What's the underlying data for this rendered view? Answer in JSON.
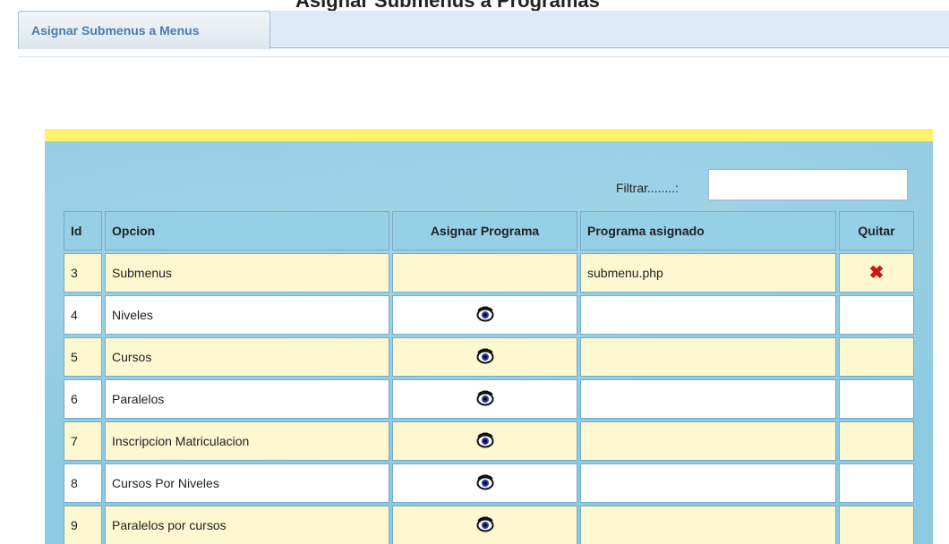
{
  "page": {
    "heading": "Asignar Submenus a Programas"
  },
  "tabs": [
    {
      "label": "Asignar Submenus a Menus"
    }
  ],
  "filter": {
    "label": "Filtrar........:",
    "value": ""
  },
  "table": {
    "headers": [
      "Id",
      "Opcion",
      "Asignar Programa",
      "Programa asignado",
      "Quitar"
    ],
    "rows": [
      {
        "id": "3",
        "opcion": "Submenus",
        "programa": "submenu.php",
        "has_eye": false,
        "has_remove": true
      },
      {
        "id": "4",
        "opcion": "Niveles",
        "programa": "",
        "has_eye": true,
        "has_remove": false
      },
      {
        "id": "5",
        "opcion": "Cursos",
        "programa": "",
        "has_eye": true,
        "has_remove": false
      },
      {
        "id": "6",
        "opcion": "Paralelos",
        "programa": "",
        "has_eye": true,
        "has_remove": false
      },
      {
        "id": "7",
        "opcion": "Inscripcion Matriculacion",
        "programa": "",
        "has_eye": true,
        "has_remove": false
      },
      {
        "id": "8",
        "opcion": "Cursos Por Niveles",
        "programa": "",
        "has_eye": true,
        "has_remove": false
      },
      {
        "id": "9",
        "opcion": "Paralelos por cursos",
        "programa": "",
        "has_eye": true,
        "has_remove": false
      }
    ]
  },
  "icons": {
    "assign": "eye-icon",
    "remove": "close-icon"
  },
  "colors": {
    "panel_bg": "#8ccae1",
    "panel_topbar": "#fbf36a",
    "row_odd": "#fdf8cf",
    "row_even": "#ffffff",
    "tab_text": "#4b7cb0",
    "remove_icon": "#d2121a"
  }
}
